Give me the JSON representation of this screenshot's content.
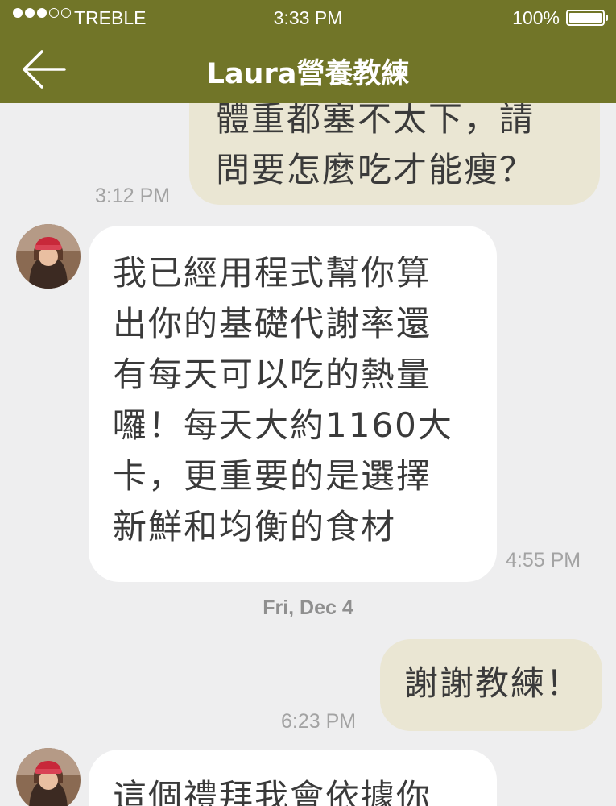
{
  "status_bar": {
    "carrier": "TREBLE",
    "time": "3:33 PM",
    "battery": "100%"
  },
  "nav": {
    "title": "Laura營養教練",
    "back_icon": "arrow-left-icon"
  },
  "messages": [
    {
      "from": "user",
      "lines": [
        "體重都塞不太下，請",
        "問要怎麼吃才能瘦？"
      ],
      "time": "3:12 PM"
    },
    {
      "from": "coach",
      "lines": [
        "我已經用程式幫你算",
        "出你的基礎代謝率還",
        "有每天可以吃的熱量",
        "囉！每天大約1160大",
        "卡，更重要的是選擇",
        "新鮮和均衡的食材"
      ],
      "time": "4:55 PM"
    },
    {
      "from": "user",
      "lines": [
        "謝謝教練！"
      ],
      "time": "6:23 PM"
    },
    {
      "from": "coach",
      "lines": [
        "這個禮拜我會依據你"
      ]
    }
  ],
  "date_divider": "Fri, Dec 4",
  "colors": {
    "header": "#717528",
    "background": "#eeeeef",
    "outgoing_bubble": "#eae6d3",
    "incoming_bubble": "#ffffff"
  }
}
